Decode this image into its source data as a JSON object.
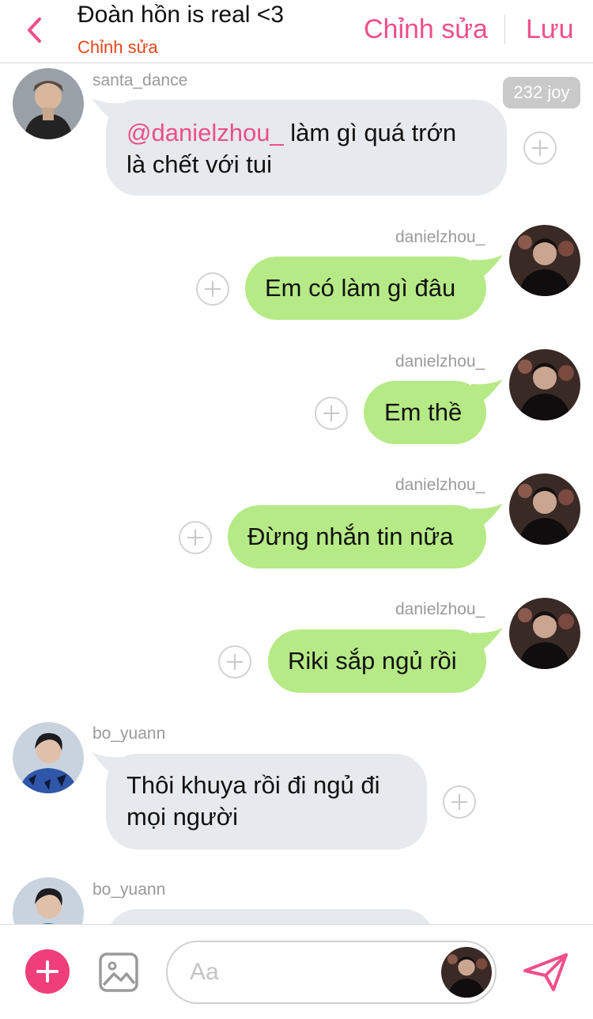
{
  "header": {
    "title": "Đoàn hồn is real <3",
    "subtitle": "Chỉnh sửa",
    "edit_label": "Chỉnh sửa",
    "save_label": "Lưu",
    "accent_color": "#ef4f8a"
  },
  "badge": {
    "text": "232 joy"
  },
  "messages": [
    {
      "user": "santa_dance",
      "side": "in",
      "mention": "@danielzhou_",
      "text": " làm gì quá trớn",
      "text2": "là chết với tui"
    },
    {
      "user": "danielzhou_",
      "side": "out",
      "text": "Em có làm gì đâu"
    },
    {
      "user": "danielzhou_",
      "side": "out",
      "text": "Em thề"
    },
    {
      "user": "danielzhou_",
      "side": "out",
      "text": "Đừng nhắn tin nữa"
    },
    {
      "user": "danielzhou_",
      "side": "out",
      "text": "Riki sắp ngủ rồi"
    },
    {
      "user": "bo_yuann",
      "side": "in",
      "text": "Thôi khuya rồi đi ngủ đi",
      "text2": "mọi người"
    },
    {
      "user": "bo_yuann",
      "side": "in",
      "text": ""
    }
  ],
  "composer": {
    "placeholder": "Aa",
    "add_color": "#ef3e7a",
    "send_color": "#ef4f8a"
  },
  "bubble_colors": {
    "incoming": "#e6e9ed",
    "outgoing": "#b6ea86"
  }
}
